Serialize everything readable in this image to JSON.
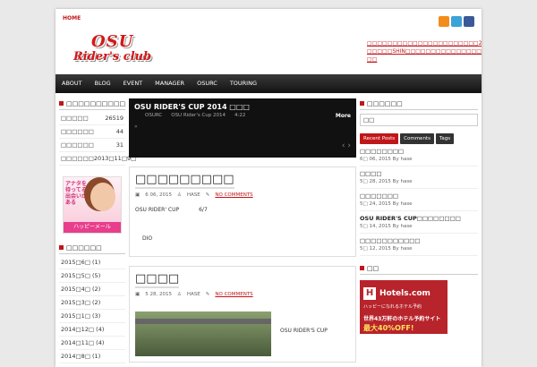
{
  "top_nav": {
    "home": "HOME"
  },
  "logo": {
    "line1": "OSU",
    "line2": "Rider's club"
  },
  "header_links": {
    "text": "□□□□□□□□□□□□□□□□□□□□□□21 □□□□□SHIN□□□□□□□□□□□□□□□□□□□□21 □□"
  },
  "main_nav": [
    "ABOUT",
    "BLOG",
    "EVENT",
    "MANAGER",
    "OSURC",
    "TOURING"
  ],
  "left": {
    "stats_title": "□□□□□□□□□□",
    "stats": [
      {
        "label": "□□□□□",
        "value": "26519"
      },
      {
        "label": "□□□□□□",
        "value": "44"
      },
      {
        "label": "□□□□□□",
        "value": "31"
      },
      {
        "label": "□□□□□□",
        "value": "2013□11□9□"
      }
    ],
    "ad": {
      "text": "アナタを待ってる出会いがある",
      "banner": "ハッピーメール"
    },
    "archive_title": "□□□□□□",
    "archive": [
      "2015□6□ (1)",
      "2015□5□ (5)",
      "2015□4□ (2)",
      "2015□3□ (2)",
      "2015□1□ (3)",
      "2014□12□ (4)",
      "2014□11□ (4)",
      "2014□8□ (1)"
    ]
  },
  "slider": {
    "title": "OSU RIDER'S CUP 2014 □□□",
    "meta": [
      "OSURC",
      "OSU Rider's Cup 2014",
      "4:22"
    ],
    "more": "More",
    "dot": "»"
  },
  "posts": [
    {
      "title": "□□□□□□□□□",
      "date": "6 06, 2015",
      "author": "HASE",
      "comments": "NO COMMENTS",
      "excerpt_a": "OSU RIDER' CUP",
      "excerpt_b": "6/7",
      "excerpt_c": "DIO"
    },
    {
      "title": "□□□□",
      "date": "5 28, 2015",
      "author": "HASE",
      "comments": "NO COMMENTS",
      "excerpt_a": "OSU RIDER'S CUP"
    }
  ],
  "right": {
    "search_title": "□□□□□□",
    "search_value": "□□",
    "tabs": [
      "Recent Posts",
      "Comments",
      "Tags"
    ],
    "recent": [
      {
        "title": "□□□□□□□□",
        "date": "6□ 06, 2015 By hase"
      },
      {
        "title": "□□□□",
        "date": "5□ 28, 2015 By hase"
      },
      {
        "title": "□□□□□□□",
        "date": "5□ 24, 2015 By hase"
      },
      {
        "title": "OSU RIDER'S CUP□□□□□□□□",
        "date": "5□ 14, 2015 By hase"
      },
      {
        "title": "□□□□□□□□□□□",
        "date": "5□ 12, 2015 By hase"
      }
    ],
    "ad_title": "□□",
    "hotels": {
      "name": "Hotels.com",
      "tagline": "ハッピーになれるホテル予約",
      "body": "世界43万軒のホテル予約サイト",
      "promo": "最大40%OFF!"
    }
  }
}
